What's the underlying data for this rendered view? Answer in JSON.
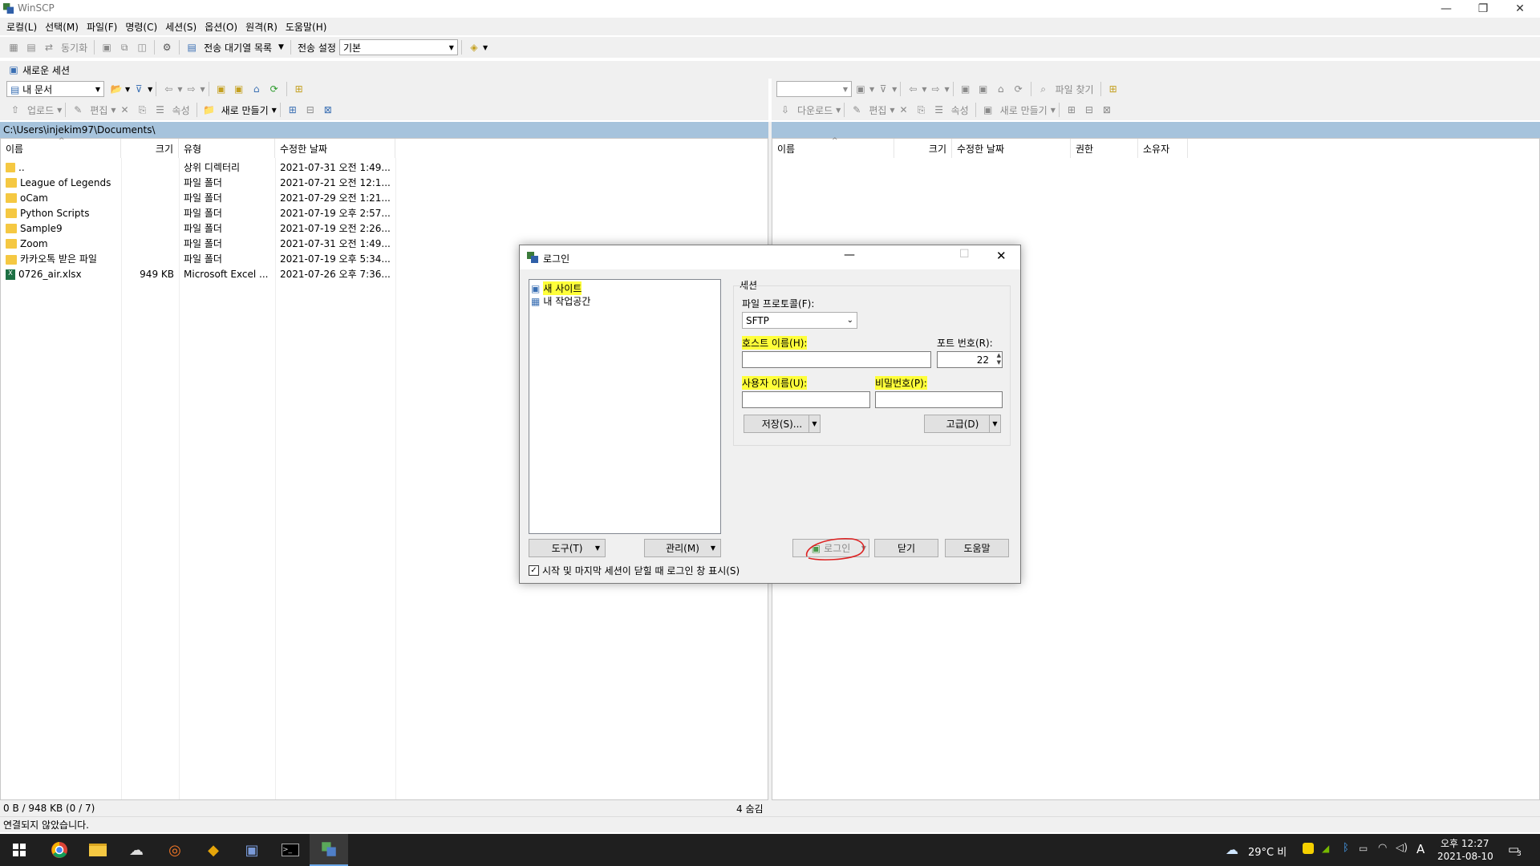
{
  "window": {
    "title": "WinSCP"
  },
  "menu": [
    "로컬(L)",
    "선택(M)",
    "파일(F)",
    "명령(C)",
    "세션(S)",
    "옵션(O)",
    "원격(R)",
    "도움말(H)"
  ],
  "toolbar1": {
    "sync": "동기화",
    "queue": "전송 대기열 목록",
    "transfer_label": "전송 설정",
    "transfer_value": "기본"
  },
  "tabs": {
    "new_session": "새로운 세션"
  },
  "left": {
    "location": "내 문서",
    "upload": "업로드",
    "edit": "편집",
    "props": "속성",
    "new": "새로 만들기",
    "path": "C:\\Users\\injekim97\\Documents\\",
    "columns": [
      "이름",
      "크기",
      "유형",
      "수정한 날짜"
    ],
    "files": [
      {
        "name": "..",
        "size": "",
        "type": "상위 디렉터리",
        "date": "2021-07-31  오전 1:49..."
      },
      {
        "name": "League of Legends",
        "size": "",
        "type": "파일 폴더",
        "date": "2021-07-21  오전 12:1..."
      },
      {
        "name": "oCam",
        "size": "",
        "type": "파일 폴더",
        "date": "2021-07-29  오전 1:21..."
      },
      {
        "name": "Python Scripts",
        "size": "",
        "type": "파일 폴더",
        "date": "2021-07-19  오후 2:57..."
      },
      {
        "name": "Sample9",
        "size": "",
        "type": "파일 폴더",
        "date": "2021-07-19  오전 2:26..."
      },
      {
        "name": "Zoom",
        "size": "",
        "type": "파일 폴더",
        "date": "2021-07-31  오전 1:49..."
      },
      {
        "name": "카카오톡 받은 파일",
        "size": "",
        "type": "파일 폴더",
        "date": "2021-07-19  오후 5:34..."
      },
      {
        "name": "0726_air.xlsx",
        "size": "949 KB",
        "type": "Microsoft Excel ...",
        "date": "2021-07-26  오후 7:36..."
      }
    ],
    "status": "0 B / 948 KB (0 / 7)",
    "hidden": "4 숨김"
  },
  "right": {
    "download": "다운로드",
    "edit": "편집",
    "props": "속성",
    "new": "새로 만들기",
    "find": "파일 찾기",
    "columns": [
      "이름",
      "크기",
      "수정한 날짜",
      "권한",
      "소유자"
    ]
  },
  "status": {
    "connection": "연결되지 않았습니다."
  },
  "dialog": {
    "title": "로그인",
    "sites": [
      "새 사이트",
      "내 작업공간"
    ],
    "session_group": "세션",
    "protocol_label": "파일 프로토콜(F):",
    "protocol_value": "SFTP",
    "host_label": "호스트 이름(H):",
    "host_value": "",
    "port_label": "포트 번호(R):",
    "port_value": "22",
    "user_label": "사용자 이름(U):",
    "user_value": "",
    "pass_label": "비밀번호(P):",
    "pass_value": "",
    "save": "저장(S)...",
    "advanced": "고급(D)",
    "tools": "도구(T)",
    "manage": "관리(M)",
    "login": "로그인",
    "close": "닫기",
    "help": "도움말",
    "show_login_checkbox": "시작 및 마지막 세션이 닫힐 때 로그인 창 표시(S)"
  },
  "taskbar": {
    "weather": "29°C  비",
    "ime": "A",
    "time": "오후 12:27",
    "date": "2021-08-10",
    "notifications": "3"
  }
}
